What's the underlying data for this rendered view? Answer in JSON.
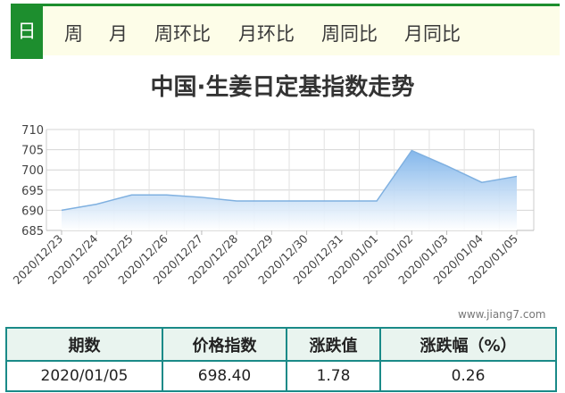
{
  "tabs": [
    {
      "label": "日",
      "active": true
    },
    {
      "label": "周",
      "active": false
    },
    {
      "label": "月",
      "active": false
    },
    {
      "label": "周环比",
      "active": false
    },
    {
      "label": "月环比",
      "active": false
    },
    {
      "label": "周同比",
      "active": false
    },
    {
      "label": "月同比",
      "active": false
    }
  ],
  "chart_data": {
    "type": "area",
    "title": "中国·生姜日定基指数走势",
    "xlabel": "",
    "ylabel": "",
    "x": [
      "2020/12/23",
      "2020/12/24",
      "2020/12/25",
      "2020/12/26",
      "2020/12/27",
      "2020/12/28",
      "2020/12/29",
      "2020/12/30",
      "2020/12/31",
      "2020/01/01",
      "2020/01/02",
      "2020/01/03",
      "2020/01/04",
      "2020/01/05"
    ],
    "series": [
      {
        "values": [
          690.0,
          691.5,
          693.8,
          693.8,
          693.2,
          692.3,
          692.3,
          692.3,
          692.3,
          692.3,
          704.8,
          701.0,
          696.9,
          698.4
        ]
      }
    ],
    "ylim": [
      685,
      710
    ],
    "yticks": [
      710,
      705,
      700,
      695,
      690,
      685
    ],
    "grid": true,
    "legend": "none",
    "line_color": "#7fb0e0",
    "fill_top_color": "#7db3ea",
    "fill_bottom_color": "#ffffff"
  },
  "watermark": "www.jiang7.com",
  "table": {
    "headers": [
      "期数",
      "价格指数",
      "涨跌值",
      "涨跌幅（%）"
    ],
    "row": [
      "2020/01/05",
      "698.40",
      "1.78",
      "0.26"
    ]
  }
}
